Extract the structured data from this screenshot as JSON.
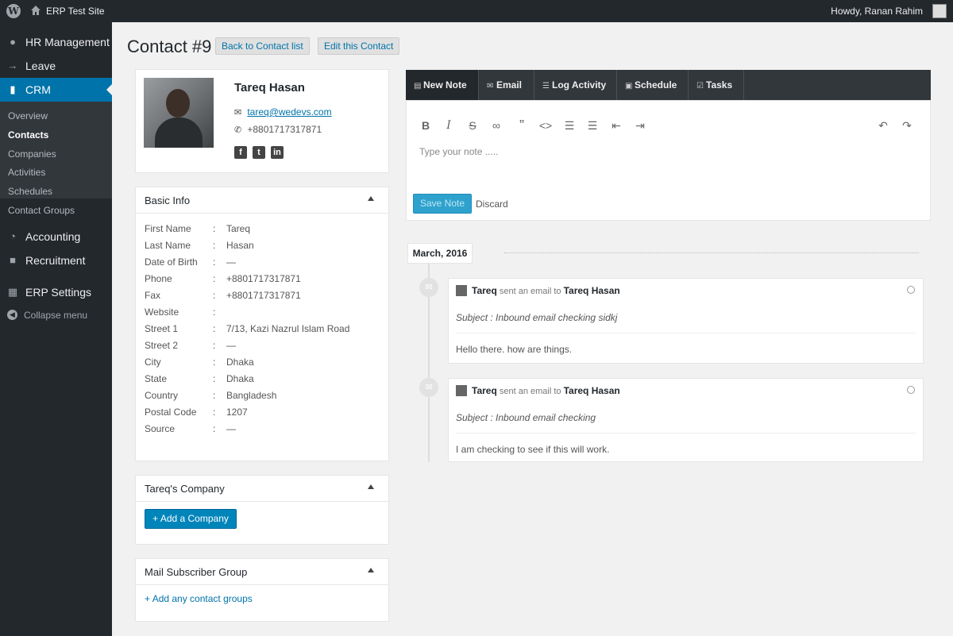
{
  "adminbar": {
    "site_name": "ERP Test Site",
    "howdy": "Howdy, Ranan Rahim"
  },
  "sidebar": {
    "items": [
      {
        "label": "HR Management",
        "icon": "people-icon"
      },
      {
        "label": "Leave",
        "icon": "arrow-right-icon"
      },
      {
        "label": "CRM",
        "icon": "bar-chart-icon"
      },
      {
        "label": "Accounting",
        "icon": "pie-chart-icon"
      },
      {
        "label": "Recruitment",
        "icon": "person-lock-icon"
      },
      {
        "label": "ERP Settings",
        "icon": "settings-icon"
      }
    ],
    "submenu": [
      "Overview",
      "Contacts",
      "Companies",
      "Activities",
      "Schedules",
      "Contact Groups"
    ],
    "current_submenu": "Contacts",
    "collapse": "Collapse menu"
  },
  "header": {
    "title": "Contact #9",
    "back_button": "Back to Contact list",
    "edit_button": "Edit this Contact"
  },
  "profile": {
    "name": "Tareq Hasan",
    "email": "tareq@wedevs.com",
    "phone": "+8801717317871",
    "social": [
      "facebook-icon",
      "twitter-icon",
      "linkedin-icon"
    ]
  },
  "basic_info": {
    "title": "Basic Info",
    "rows": [
      {
        "key": "First Name",
        "value": "Tareq"
      },
      {
        "key": "Last Name",
        "value": "Hasan"
      },
      {
        "key": "Date of Birth",
        "value": "—"
      },
      {
        "key": "Phone",
        "value": "+8801717317871"
      },
      {
        "key": "Fax",
        "value": "+8801717317871"
      },
      {
        "key": "Website",
        "value": ""
      },
      {
        "key": "Street 1",
        "value": "7/13, Kazi Nazrul Islam Road"
      },
      {
        "key": "Street 2",
        "value": "—"
      },
      {
        "key": "City",
        "value": "Dhaka"
      },
      {
        "key": "State",
        "value": "Dhaka"
      },
      {
        "key": "Country",
        "value": "Bangladesh"
      },
      {
        "key": "Postal Code",
        "value": "1207"
      },
      {
        "key": "Source",
        "value": "—"
      }
    ]
  },
  "company": {
    "title": "Tareq's Company",
    "add_button": "Add a Company"
  },
  "mail_group": {
    "title": "Mail Subscriber Group",
    "add_link": "Add any contact groups"
  },
  "tabs": [
    {
      "label": "New Note",
      "icon": "note-icon"
    },
    {
      "label": "Email",
      "icon": "email-icon"
    },
    {
      "label": "Log Activity",
      "icon": "list-icon"
    },
    {
      "label": "Schedule",
      "icon": "calendar-icon"
    },
    {
      "label": "Tasks",
      "icon": "check-icon"
    }
  ],
  "editor": {
    "placeholder": "Type your note .....",
    "save_button": "Save Note",
    "discard": "Discard"
  },
  "timeline": {
    "date": "March, 2016",
    "entries": [
      {
        "actor": "Tareq",
        "action": "sent an email to",
        "target": "Tareq Hasan",
        "subject": "Subject : Inbound email checking sidkj",
        "message": "Hello there. how are things."
      },
      {
        "actor": "Tareq",
        "action": "sent an email to",
        "target": "Tareq Hasan",
        "subject": "Subject : Inbound email checking",
        "message": "I am checking to see if this will work."
      }
    ]
  }
}
